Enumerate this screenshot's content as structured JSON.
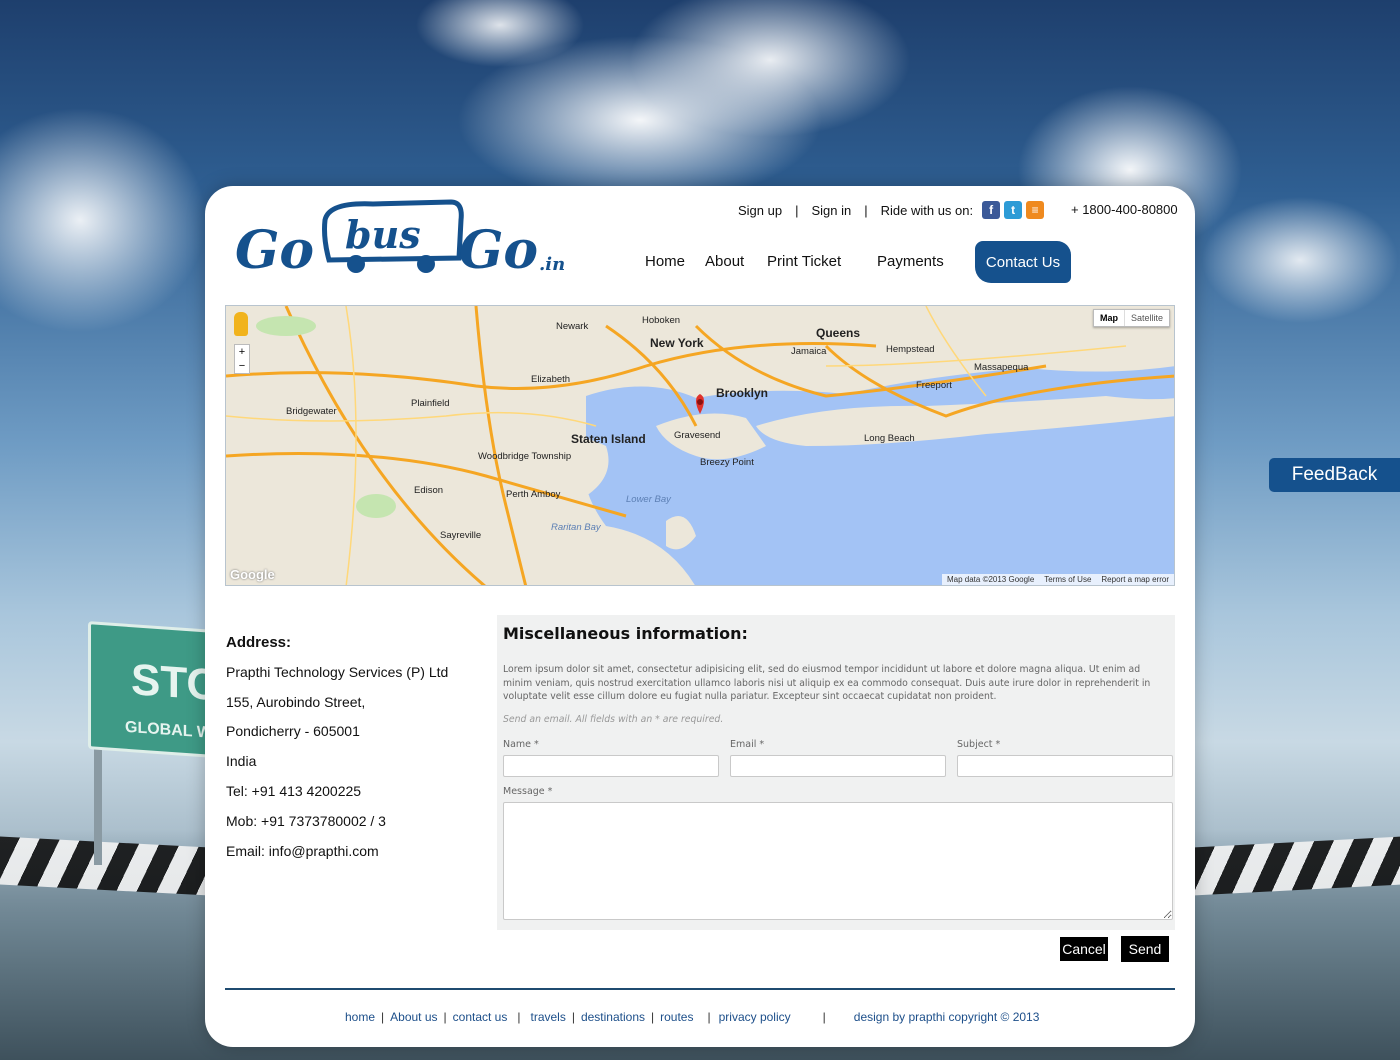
{
  "brand": {
    "logo_text_left": "Go",
    "logo_text_mid": "bus",
    "logo_text_right": "Go",
    "logo_suffix": ".in",
    "brand_color": "#15518d"
  },
  "top_links": {
    "sign_up": "Sign up",
    "sep1": "|",
    "sign_in": "Sign in",
    "sep2": "|",
    "ride_with_us": "Ride with us on:",
    "social": [
      {
        "icon": "facebook-icon",
        "glyph": "f"
      },
      {
        "icon": "twitter-icon",
        "glyph": "t"
      },
      {
        "icon": "rss-icon",
        "glyph": "≡"
      }
    ],
    "phone": "+ 1800-400-80800"
  },
  "nav": {
    "home": "Home",
    "about": "About",
    "print_ticket": "Print Ticket",
    "payments": "Payments",
    "contact_us": "Contact Us"
  },
  "map": {
    "type_map": "Map",
    "type_satellite": "Satellite",
    "zoom_in": "+",
    "zoom_out": "−",
    "google_mark": "Google",
    "footer_data": "Map data ©2013 Google",
    "footer_terms": "Terms of Use",
    "footer_report": "Report a map error",
    "labels": {
      "new_york": "New York",
      "brooklyn": "Brooklyn",
      "queens": "Queens",
      "newark": "Newark",
      "hoboken": "Hoboken",
      "elizabeth": "Elizabeth",
      "staten_island": "Staten Island",
      "gravesend": "Gravesend",
      "long_beach": "Long Beach",
      "hempstead": "Hempstead",
      "jamaica": "Jamaica",
      "edison": "Edison",
      "woodbridge": "Woodbridge Township",
      "perth_amboy": "Perth Amboy",
      "sayreville": "Sayreville",
      "lower_bay": "Lower Bay",
      "raritan_bay": "Raritan Bay",
      "breezy_point": "Breezy Point",
      "freeport": "Freeport",
      "massapequa": "Massapequa",
      "plainfield": "Plainfield",
      "bridgewater": "Bridgewater"
    }
  },
  "address": {
    "heading": "Address:",
    "company": "Prapthi Technology Services (P) Ltd",
    "street": "155, Aurobindo Street,",
    "city": "Pondicherry - 605001",
    "country": "India",
    "tel": "Tel: +91 413 4200225",
    "mob": "Mob: +91 7373780002 / 3",
    "email": "Email: info@prapthi.com"
  },
  "misc": {
    "heading": "Miscellaneous information:",
    "paragraph": "Lorem ipsum dolor sit amet, consectetur adipisicing elit, sed do eiusmod tempor incididunt ut labore et dolore magna aliqua. Ut enim ad minim veniam, quis nostrud exercitation ullamco laboris nisi ut aliquip ex ea commodo consequat. Duis aute irure dolor in reprehenderit in voluptate velit esse cillum dolore eu fugiat nulla pariatur. Excepteur sint occaecat cupidatat non proident.",
    "note": "Send an email. All fields with an * are required.",
    "name_label": "Name *",
    "email_label": "Email *",
    "subject_label": "Subject *",
    "message_label": "Message *",
    "name_value": "",
    "email_value": "",
    "subject_value": "",
    "message_value": ""
  },
  "buttons": {
    "cancel": "Cancel",
    "send": "Send"
  },
  "footer": {
    "home": "home",
    "about_us": "About us",
    "contact_us": "contact us",
    "travels": "travels",
    "destinations": "destinations",
    "routes": "routes",
    "privacy_policy": "privacy policy",
    "sep": "|",
    "credit": "design by prapthi copyright © 2013"
  },
  "feedback": "FeedBack"
}
